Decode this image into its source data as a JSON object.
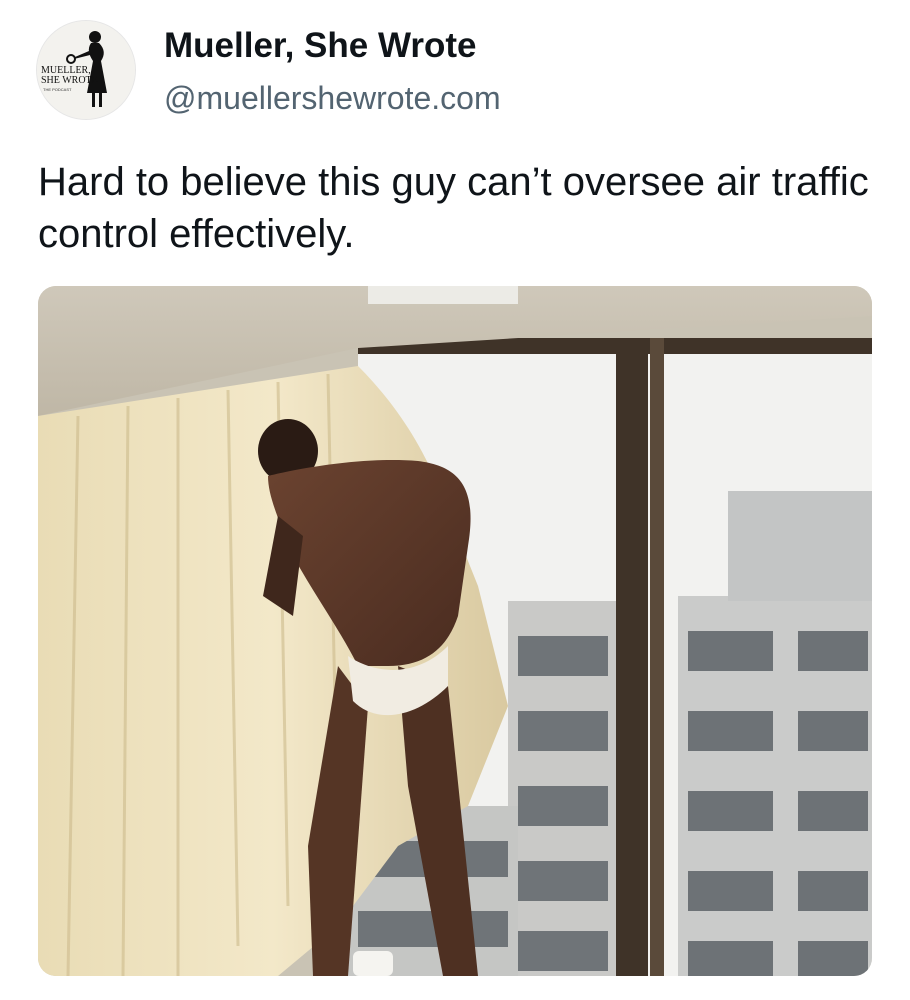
{
  "author": {
    "display_name": "Mueller, She Wrote",
    "handle": "@muellershewrote.com",
    "avatar": {
      "icon": "podcast-logo-woman-silhouette-icon",
      "logo_lines": [
        "MUELLER,",
        "SHE WROTE",
        "THE PODCAST"
      ]
    }
  },
  "post": {
    "text": "Hard to believe this guy can’t oversee air traffic control effectively."
  },
  "media": {
    "icon": "video-still-image",
    "caption_fragment": "",
    "colors": {
      "ceiling": "#d8d2c6",
      "curtain": "#eee2bf",
      "window_frame": "#4a3c30",
      "sky": "#f4f4f2",
      "building": "#c8cacb"
    }
  }
}
